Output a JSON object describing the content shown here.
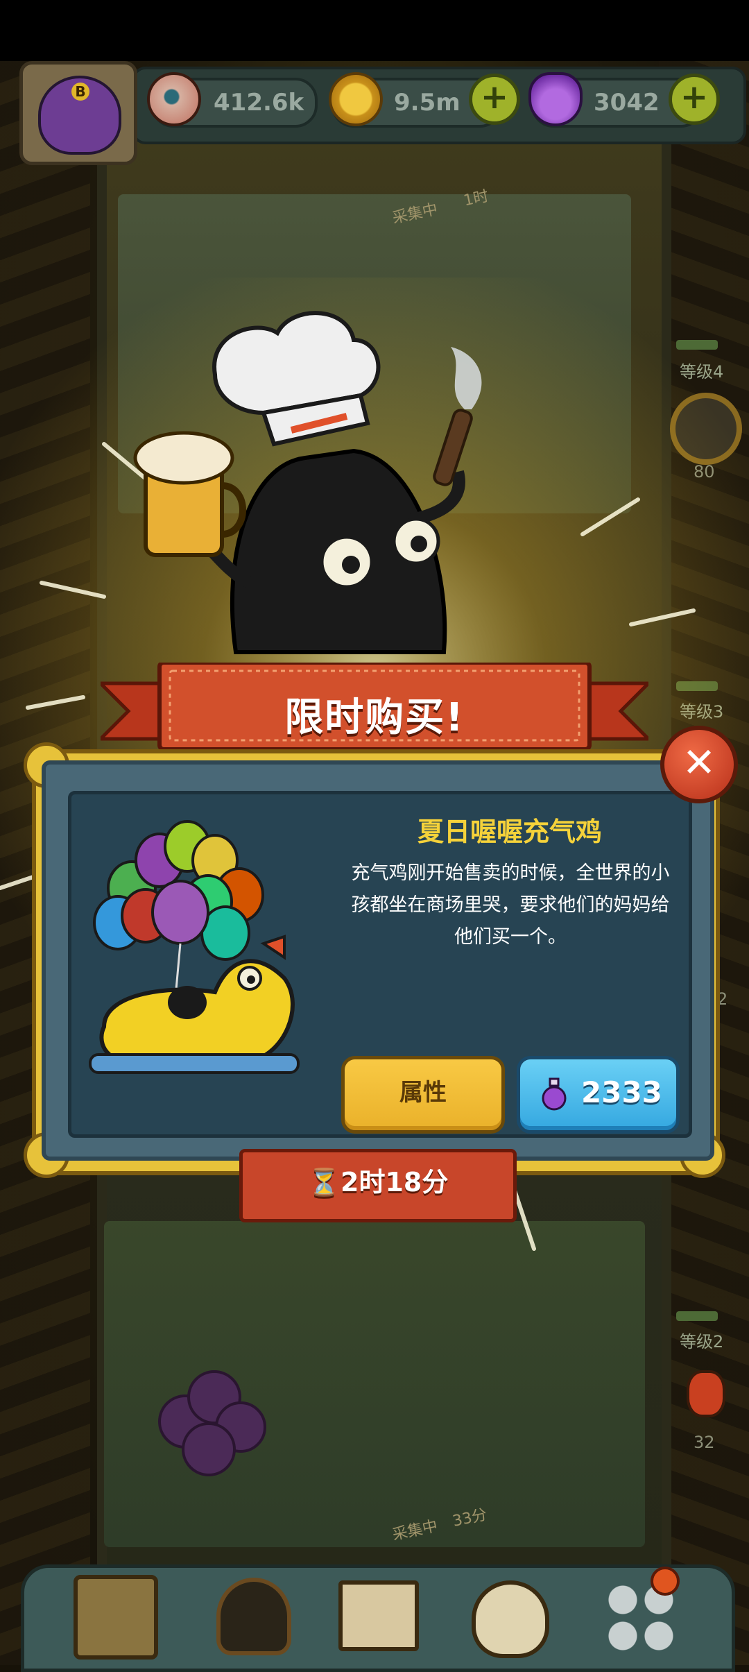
{
  "resources": {
    "eyes": "412.6k",
    "coins": "9.5m",
    "potions": "3042"
  },
  "floors": {
    "upper": {
      "status": "采集中",
      "time": "1时"
    },
    "lower": {
      "status": "采集中",
      "time": "33分"
    }
  },
  "side_levels": {
    "level4": {
      "label": "等级4",
      "count": "80"
    },
    "level3": {
      "label": "等级3"
    },
    "level2": {
      "label": "等级2",
      "count": "32"
    },
    "partial_count": "2"
  },
  "offer": {
    "title": "限时购买!",
    "item_name": "夏日喔喔充气鸡",
    "description": "充气鸡刚开始售卖的时候，全世界的小孩都坐在商场里哭，要求他们的妈妈给他们买一个。",
    "properties_label": "属性",
    "price": "2333",
    "timer": "2时18分"
  },
  "colors": {
    "accent_yellow": "#f5d23a",
    "ribbon_red": "#c8462a",
    "panel_teal": "#274453",
    "buy_blue": "#34a7e0"
  }
}
